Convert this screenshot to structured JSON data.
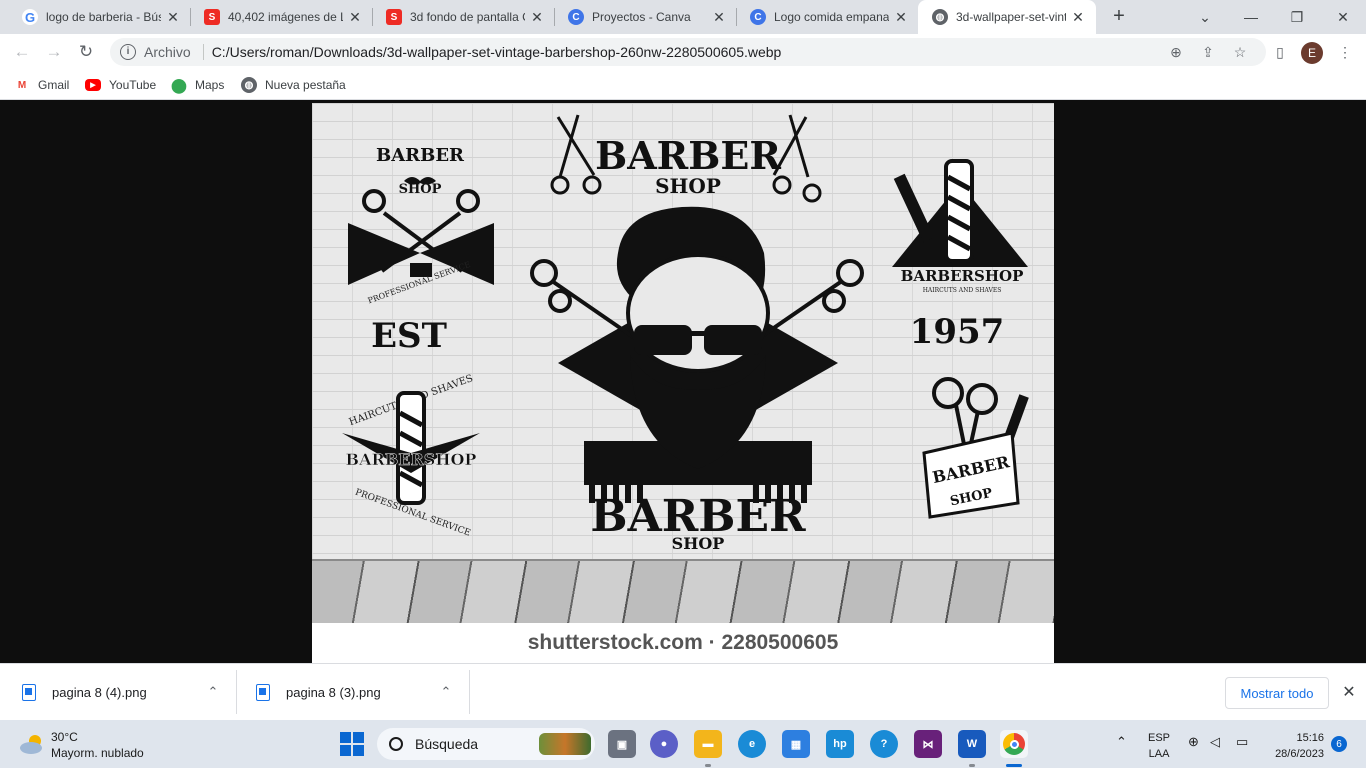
{
  "browser": {
    "tabs": [
      {
        "title": "logo de barberia - Bús",
        "favicon": "google-icon",
        "color": "#ffffff"
      },
      {
        "title": "40,402 imágenes de Lo",
        "favicon": "shutterstock-icon",
        "color": "#ee2b24"
      },
      {
        "title": "3d fondo de pantalla C",
        "favicon": "shutterstock-icon",
        "color": "#ee2b24"
      },
      {
        "title": "Proyectos - Canva",
        "favicon": "canva-icon",
        "color": "#3f75e8"
      },
      {
        "title": "Logo comida empana",
        "favicon": "canva-icon",
        "color": "#3f75e8"
      },
      {
        "title": "3d-wallpaper-set-vinta",
        "favicon": "globe-icon",
        "color": "#5f6368"
      }
    ],
    "address": {
      "scheme_label": "Archivo",
      "url": "C:/Users/roman/Downloads/3d-wallpaper-set-vintage-barbershop-260nw-2280500605.webp"
    },
    "profile_initial": "E",
    "bookmarks": [
      {
        "label": "Gmail",
        "icon": "gmail-icon"
      },
      {
        "label": "YouTube",
        "icon": "youtube-icon"
      },
      {
        "label": "Maps",
        "icon": "maps-icon"
      },
      {
        "label": "Nueva pestaña",
        "icon": "globe-icon"
      }
    ]
  },
  "image": {
    "caption": "shutterstock.com · 2280500605",
    "texts": {
      "barber_small": "BARBER",
      "shop_small": "SHOP",
      "professional_service": "PROFESSIONAL SERVICE",
      "est": "EST",
      "year": "1957",
      "barber_top": "BARBER",
      "shop_top": "SHOP",
      "barbershop_right": "BARBERSHOP",
      "haircuts_and_shaves": "HAIRCUTS AND SHAVES",
      "haircuts_and_shaves_left": "HAIRCUTS AND SHAVES",
      "barbershop_left": "BARBERSHOP",
      "professional_service_left": "PROFESSIONAL SERVICE",
      "barber_main": "BARBER",
      "shop_main": "SHOP",
      "barber_ribbon": "BARBER",
      "shop_ribbon": "SHOP"
    }
  },
  "downloads": {
    "items": [
      {
        "name": "pagina 8 (4).png"
      },
      {
        "name": "pagina 8 (3).png"
      }
    ],
    "show_all": "Mostrar todo"
  },
  "taskbar": {
    "weather": {
      "temp": "30°C",
      "desc": "Mayorm. nublado"
    },
    "search_placeholder": "Búsqueda",
    "lang": {
      "line1": "ESP",
      "line2": "LAA"
    },
    "clock": {
      "time": "15:16",
      "date": "28/6/2023"
    },
    "notifications": "6"
  }
}
